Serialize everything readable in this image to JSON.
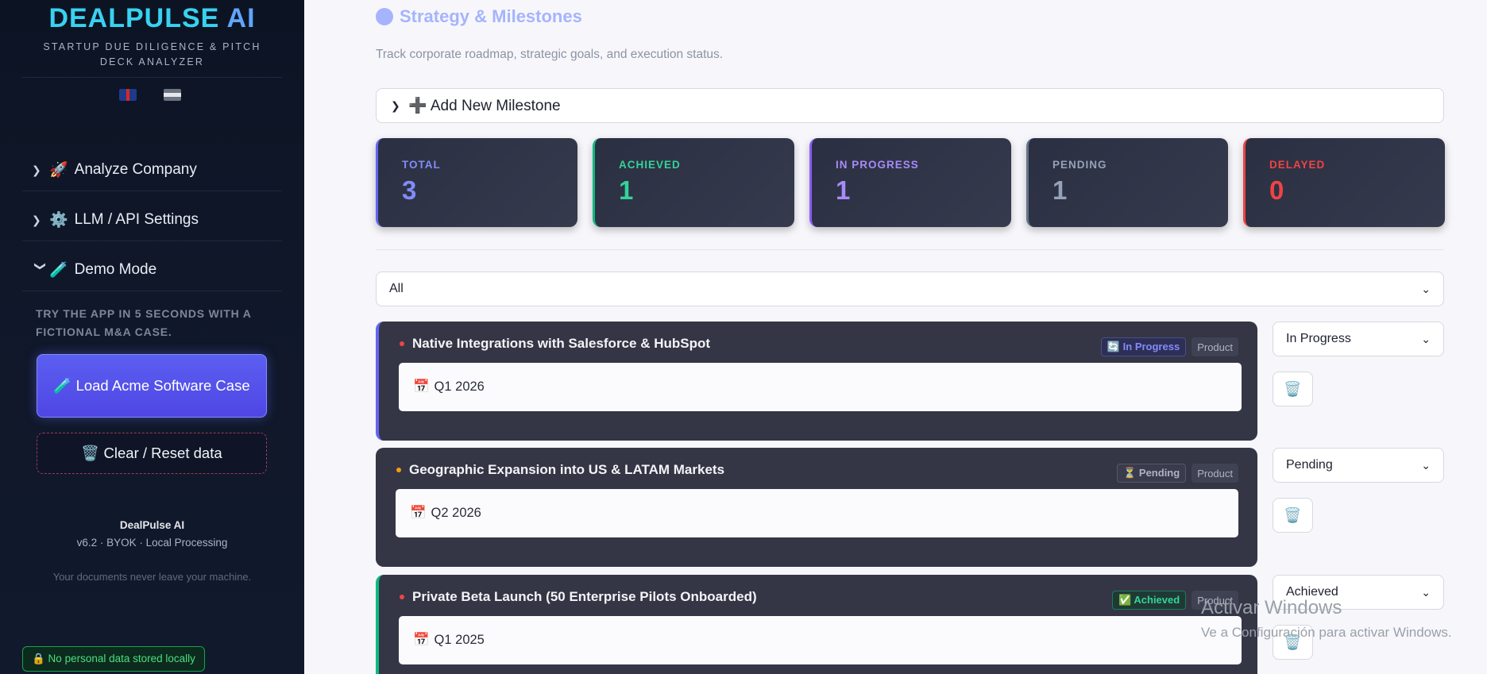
{
  "sidebar": {
    "brand_main": "DEALPULSE",
    "brand_ai": "AI",
    "tagline": "STARTUP DUE DILIGENCE & PITCH DECK ANALYZER",
    "flags": [
      "🇬🇧",
      "🇪🇸"
    ],
    "sections": [
      {
        "chevron": "›",
        "emoji": "🚀",
        "label": "Analyze Company"
      },
      {
        "chevron": "›",
        "emoji": "⚙️",
        "label": "LLM / API Settings"
      },
      {
        "chevron": "⌄",
        "emoji": "🧪",
        "label": "Demo Mode"
      }
    ],
    "demo_text": "TRY THE APP IN 5 SECONDS WITH A FICTIONAL M&A CASE.",
    "load_button": "🧪 Load Acme Software Case",
    "clear_button": "🗑️ Clear / Reset data",
    "footer_title": "DealPulse AI",
    "footer_version": "v6.2 · BYOK · Local Processing",
    "footer_note": "Your documents never leave your machine.",
    "privacy_badge": "🔒 No personal data stored locally"
  },
  "main": {
    "title": "Strategy & Milestones",
    "subtitle": "Track corporate roadmap, strategic goals, and execution status.",
    "add_milestone": "➕ Add New Milestone",
    "stats": [
      {
        "label": "TOTAL",
        "value": "3",
        "color": "#818cf8"
      },
      {
        "label": "ACHIEVED",
        "value": "1",
        "color": "#34d399"
      },
      {
        "label": "IN PROGRESS",
        "value": "1",
        "color": "#a78bfa"
      },
      {
        "label": "PENDING",
        "value": "1",
        "color": "#94a3b8"
      },
      {
        "label": "DELAYED",
        "value": "0",
        "color": "#ef4444"
      }
    ],
    "filter_value": "All",
    "milestones": [
      {
        "title": "Native Integrations with Salesforce & HubSpot",
        "status_badge": "🔄 In Progress",
        "category": "Product",
        "date": "Q1 2026",
        "status_select": "In Progress",
        "accent": "#6366f1",
        "bullet": "#ef4444"
      },
      {
        "title": "Geographic Expansion into US & LATAM Markets",
        "status_badge": "⏳ Pending",
        "category": "Product",
        "date": "Q2 2026",
        "status_select": "Pending",
        "accent": "#343646",
        "bullet": "#f59e0b"
      },
      {
        "title": "Private Beta Launch (50 Enterprise Pilots Onboarded)",
        "status_badge": "✅ Achieved",
        "category": "Product",
        "date": "Q1 2025",
        "status_select": "Achieved",
        "accent": "#10b981",
        "bullet": "#ef4444"
      }
    ]
  },
  "os_watermark": {
    "line1": "Activar Windows",
    "line2": "Ve a Configuración para activar Windows."
  }
}
